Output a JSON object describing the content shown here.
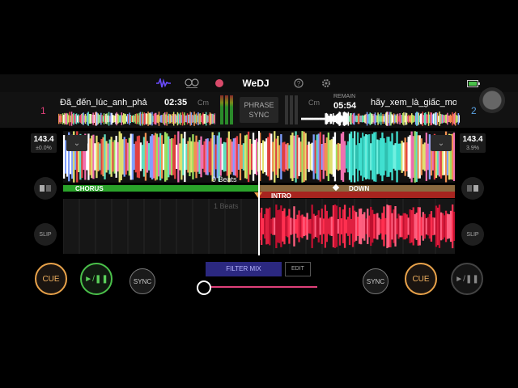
{
  "app": {
    "brand": "WeDJ"
  },
  "topbar": {
    "icons": [
      "waveform-icon",
      "mixer-icon",
      "record-icon",
      "help-icon",
      "settings-icon",
      "battery-icon"
    ],
    "colors": {
      "waveform": "#6a4cff",
      "record": "#d94a6a",
      "battery": "#4ac04a"
    }
  },
  "deck1": {
    "number": "1",
    "track": "Đã_đến_lúc_anh_phả",
    "time": "02:35",
    "key": "Cm",
    "bpm": "143.4",
    "pitch": "±0.0%",
    "cue_label": "CUE",
    "play_label": "►/❚❚",
    "sync_label": "SYNC",
    "slip_label": "SLIP",
    "color": "#e0407a"
  },
  "deck2": {
    "number": "2",
    "track": "hãy_xem_là_giấc_mơ",
    "remain_label": "REMAIN",
    "time": "05:54",
    "key": "Cm",
    "bpm": "143.4",
    "pitch": "3.9%",
    "cue_label": "CUE",
    "play_label": "►/❚❚",
    "sync_label": "SYNC",
    "slip_label": "SLIP",
    "color": "#5aa0e0"
  },
  "center": {
    "phrase_sync": "PHRASE\nSYNC",
    "phrase_line1": "PHRASE",
    "phrase_line2": "SYNC",
    "filter_mix": "FILTER MIX",
    "edit": "EDIT",
    "crossfader": 0.0
  },
  "waveform": {
    "beats_top": "9 Beats",
    "beats_bottom": "1 Beats",
    "phrases": [
      "CHORUS",
      "DOWN",
      "INTRO"
    ]
  }
}
